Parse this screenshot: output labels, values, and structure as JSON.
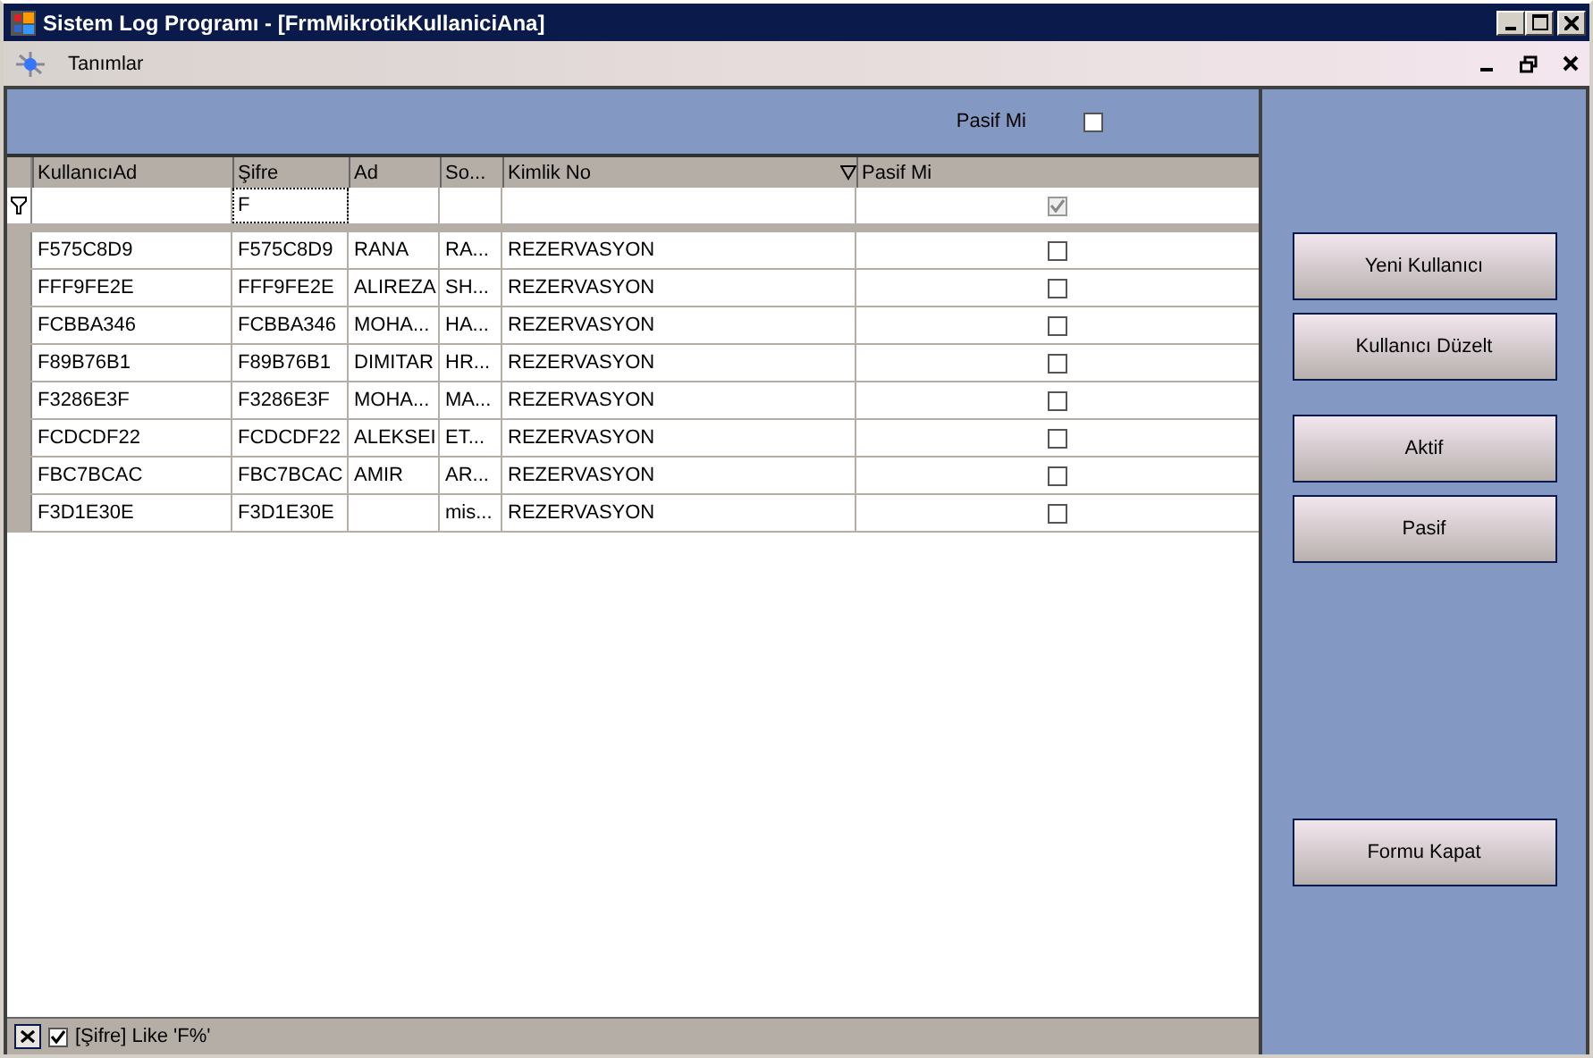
{
  "window": {
    "title": "Sistem Log Programı - [FrmMikrotikKullaniciAna]"
  },
  "menu": {
    "items": [
      "Tanımlar"
    ]
  },
  "top_filter": {
    "label": "Pasif Mi",
    "checked": false
  },
  "table": {
    "columns": [
      "KullanıcıAd",
      "Şifre",
      "Ad",
      "So...",
      "Kimlik No",
      "Pasif Mi"
    ],
    "filter_row": {
      "sifre": "F",
      "pasif_checked": true
    },
    "rows": [
      {
        "cells": [
          "F575C8D9",
          "F575C8D9",
          "RANA",
          "RA...",
          "REZERVASYON"
        ],
        "pasif": false
      },
      {
        "cells": [
          "FFF9FE2E",
          "FFF9FE2E",
          "ALIREZA",
          "SH...",
          "REZERVASYON"
        ],
        "pasif": false
      },
      {
        "cells": [
          "FCBBA346",
          "FCBBA346",
          "MOHA...",
          "HA...",
          "REZERVASYON"
        ],
        "pasif": false
      },
      {
        "cells": [
          "F89B76B1",
          "F89B76B1",
          "DIMITAR",
          "HR...",
          "REZERVASYON"
        ],
        "pasif": false
      },
      {
        "cells": [
          "F3286E3F",
          "F3286E3F",
          "MOHA...",
          "MA...",
          "REZERVASYON"
        ],
        "pasif": false
      },
      {
        "cells": [
          "FCDCDF22",
          "FCDCDF22",
          "ALEKSEI",
          "ET...",
          "REZERVASYON"
        ],
        "pasif": false
      },
      {
        "cells": [
          "FBC7BCAC",
          "FBC7BCAC",
          "AMIR",
          "AR...",
          "REZERVASYON"
        ],
        "pasif": false
      },
      {
        "cells": [
          "F3D1E30E",
          "F3D1E30E",
          "",
          "mis...",
          "REZERVASYON"
        ],
        "pasif": false
      }
    ]
  },
  "filter_bar": {
    "enabled": true,
    "text": "[Şifre] Like 'F%'"
  },
  "buttons": [
    {
      "label": "Yeni Kullanıcı"
    },
    {
      "label": "Kullanıcı Düzelt"
    },
    {
      "label": "Aktif"
    },
    {
      "label": "Pasif"
    },
    {
      "label": "Formu Kapat"
    }
  ]
}
